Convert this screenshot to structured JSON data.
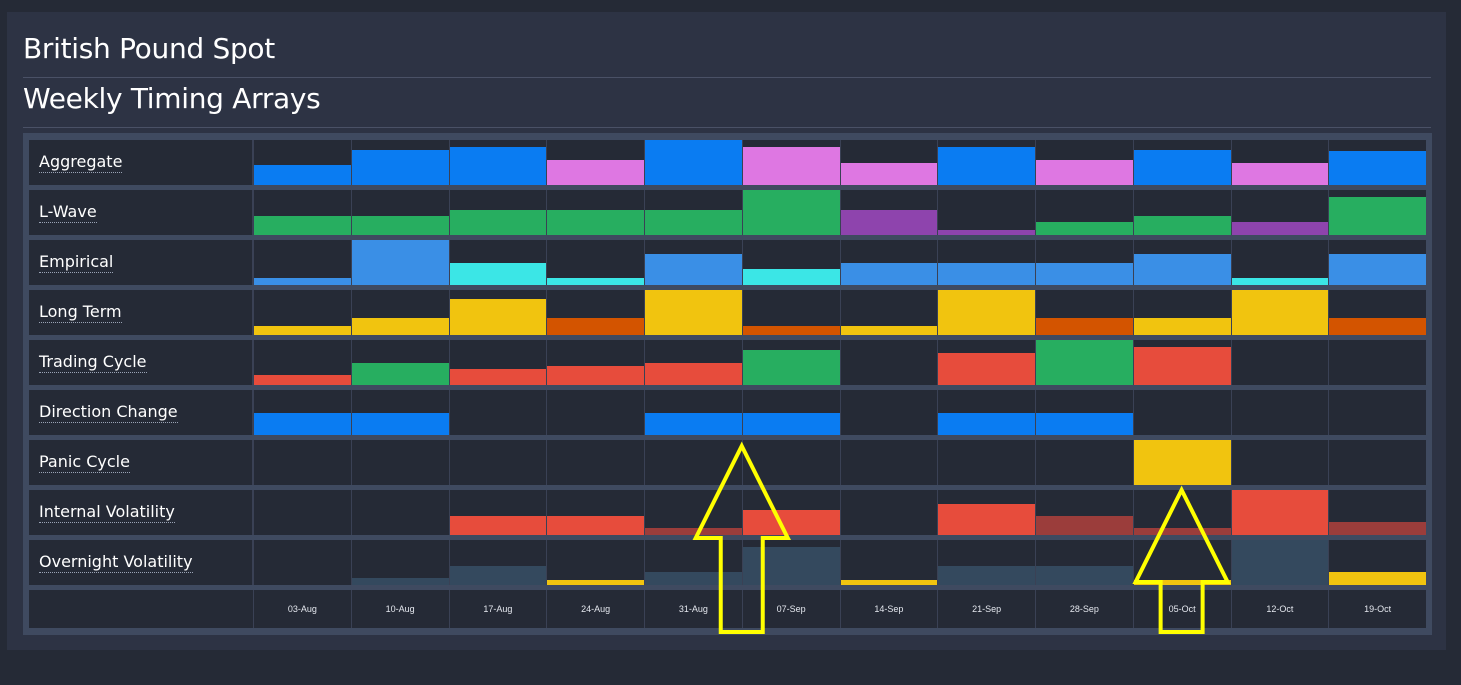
{
  "header": {
    "title": "British Pound Spot",
    "subtitle": "Weekly Timing Arrays"
  },
  "colors": {
    "blue": "#0a7cf2",
    "lightblue": "#3a8fe6",
    "pink": "#de77e2",
    "green": "#27ae60",
    "purple": "#8e44ad",
    "cyan": "#3be6e6",
    "yellow": "#f1c40f",
    "orange": "#d35400",
    "red": "#e74c3c",
    "darkred": "#9b3d3b",
    "slate": "#34495e",
    "arrow": "#ffff00"
  },
  "chart_data": {
    "type": "heatmap",
    "weeks": [
      "03-Aug",
      "10-Aug",
      "17-Aug",
      "24-Aug",
      "31-Aug",
      "07-Sep",
      "14-Sep",
      "21-Sep",
      "28-Sep",
      "05-Oct",
      "12-Oct",
      "19-Oct"
    ],
    "level_scale": [
      0,
      1
    ],
    "rows": [
      {
        "label": "Aggregate",
        "levels": [
          0.45,
          0.78,
          0.85,
          0.55,
          1.0,
          0.85,
          0.5,
          0.85,
          0.55,
          0.78,
          0.5,
          0.75
        ],
        "colors": [
          "blue",
          "blue",
          "blue",
          "pink",
          "blue",
          "pink",
          "pink",
          "blue",
          "pink",
          "blue",
          "pink",
          "blue"
        ]
      },
      {
        "label": "L-Wave",
        "levels": [
          0.42,
          0.42,
          0.55,
          0.55,
          0.55,
          1.0,
          0.55,
          0.12,
          0.28,
          0.42,
          0.28,
          0.85
        ],
        "colors": [
          "green",
          "green",
          "green",
          "green",
          "green",
          "green",
          "purple",
          "purple",
          "green",
          "green",
          "purple",
          "green"
        ]
      },
      {
        "label": "Empirical",
        "levels": [
          0.15,
          1.0,
          0.5,
          0.15,
          0.68,
          0.35,
          0.5,
          0.5,
          0.5,
          0.68,
          0.15,
          0.68
        ],
        "colors": [
          "lightblue",
          "lightblue",
          "cyan",
          "cyan",
          "lightblue",
          "cyan",
          "lightblue",
          "lightblue",
          "lightblue",
          "lightblue",
          "cyan",
          "lightblue"
        ]
      },
      {
        "label": "Long Term",
        "levels": [
          0.2,
          0.38,
          0.8,
          0.38,
          1.0,
          0.2,
          0.2,
          1.0,
          0.38,
          0.38,
          1.0,
          0.38
        ],
        "colors": [
          "yellow",
          "yellow",
          "yellow",
          "orange",
          "yellow",
          "orange",
          "yellow",
          "yellow",
          "orange",
          "yellow",
          "yellow",
          "orange"
        ]
      },
      {
        "label": "Trading Cycle",
        "levels": [
          0.22,
          0.5,
          0.35,
          0.42,
          0.5,
          0.78,
          0,
          0.72,
          1.0,
          0.85,
          0,
          0
        ],
        "colors": [
          "red",
          "green",
          "red",
          "red",
          "red",
          "green",
          "",
          "red",
          "green",
          "red",
          "",
          ""
        ]
      },
      {
        "label": "Direction Change",
        "levels": [
          0.5,
          0.5,
          0,
          0,
          0.5,
          0.5,
          0,
          0.5,
          0.5,
          0,
          0,
          0
        ],
        "colors": [
          "blue",
          "blue",
          "",
          "",
          "blue",
          "blue",
          "",
          "blue",
          "blue",
          "",
          "",
          ""
        ]
      },
      {
        "label": "Panic Cycle",
        "levels": [
          0,
          0,
          0,
          0,
          0,
          0,
          0,
          0,
          0,
          1.0,
          0,
          0
        ],
        "colors": [
          "",
          "",
          "",
          "",
          "",
          "",
          "",
          "",
          "",
          "yellow",
          "",
          ""
        ]
      },
      {
        "label": "Internal Volatility",
        "levels": [
          0,
          0,
          0.42,
          0.42,
          0.15,
          0.55,
          0,
          0.7,
          0.42,
          0.15,
          1.0,
          0.28
        ],
        "colors": [
          "",
          "",
          "red",
          "red",
          "darkred",
          "red",
          "",
          "red",
          "darkred",
          "darkred",
          "red",
          "darkred"
        ]
      },
      {
        "label": "Overnight Volatility",
        "levels": [
          0,
          0.15,
          0.42,
          0.12,
          0.28,
          0.85,
          0.12,
          0.42,
          0.42,
          0.12,
          1.0,
          0.28
        ],
        "colors": [
          "",
          "slate",
          "slate",
          "yellow",
          "slate",
          "slate",
          "yellow",
          "slate",
          "slate",
          "yellow",
          "slate",
          "yellow"
        ]
      }
    ],
    "annotations": [
      {
        "type": "arrow",
        "direction": "up",
        "color": "arrow",
        "points_to_week": "07-Sep"
      },
      {
        "type": "arrow",
        "direction": "up",
        "color": "arrow",
        "points_to_week": "05-Oct"
      }
    ]
  }
}
